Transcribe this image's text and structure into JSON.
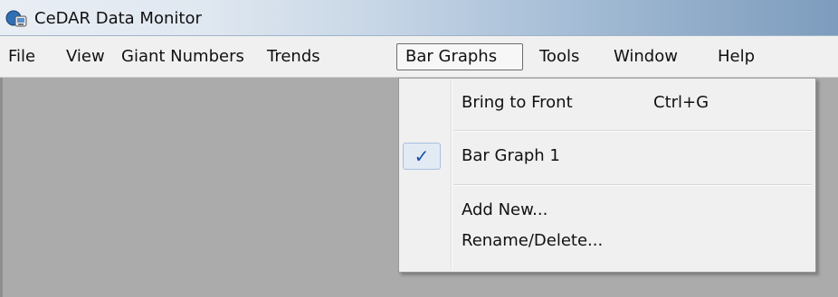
{
  "window": {
    "title": "CeDAR Data Monitor",
    "icon": "app-icon"
  },
  "menubar": {
    "items": [
      "File",
      "View",
      "Giant Numbers",
      "Trends",
      "Bar Graphs",
      "Tools",
      "Window",
      "Help"
    ],
    "open_item": "Bar Graphs"
  },
  "dropdown": {
    "bring_to_front": {
      "label": "Bring to Front",
      "shortcut": "Ctrl+G"
    },
    "bar_graph_1": {
      "label": "Bar Graph 1",
      "checked": true,
      "check_glyph": "✓"
    },
    "add_new": {
      "label": "Add New..."
    },
    "rename_delete": {
      "label": "Rename/Delete..."
    }
  }
}
